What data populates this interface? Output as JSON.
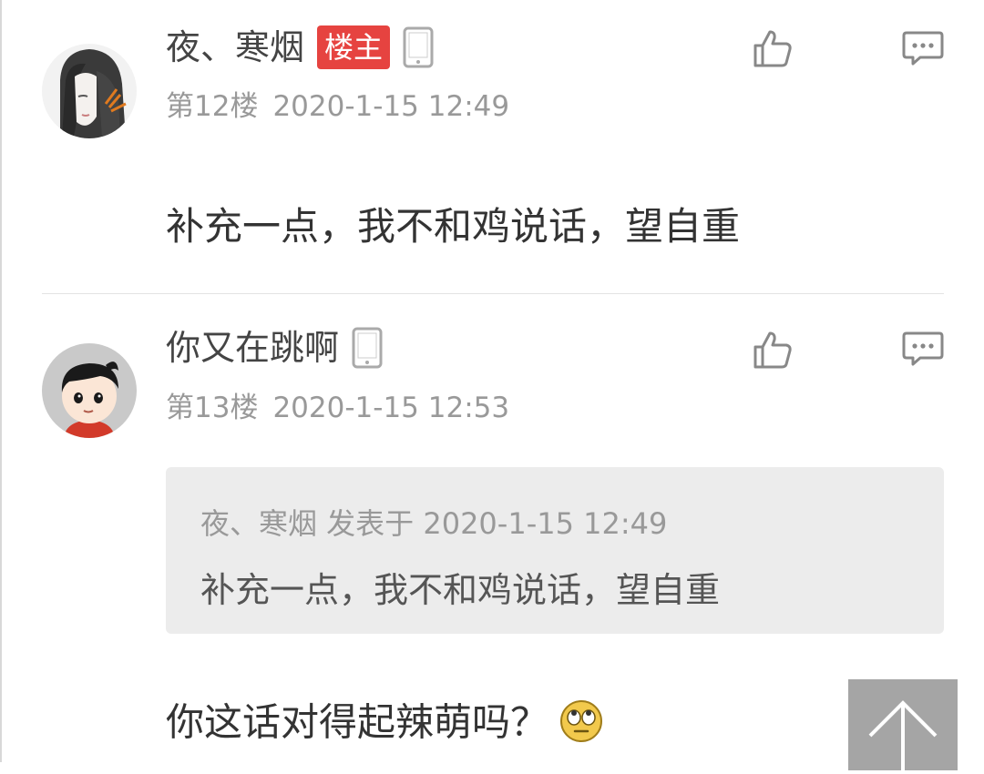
{
  "posts": [
    {
      "username": "夜、寒烟",
      "badge": "楼主",
      "floor": "第12楼",
      "time": "2020-1-15 12:49",
      "content": "补充一点，我不和鸡说话，望自重"
    },
    {
      "username": "你又在跳啊",
      "floor": "第13楼",
      "time": "2020-1-15 12:53",
      "quote": {
        "meta": "夜、寒烟 发表于 2020-1-15 12:49",
        "text": "补充一点，我不和鸡说话，望自重"
      },
      "content": "你这话对得起辣萌吗？"
    }
  ],
  "icons": {
    "like": "thumbs-up-icon",
    "reply": "comment-icon",
    "device": "mobile-phone-icon",
    "back_to_top": "arrow-up-icon"
  },
  "colors": {
    "badge": "#e64340",
    "meta_text": "#999999",
    "quote_bg": "#ececec",
    "back_top_bg": "#a5a5a5"
  }
}
